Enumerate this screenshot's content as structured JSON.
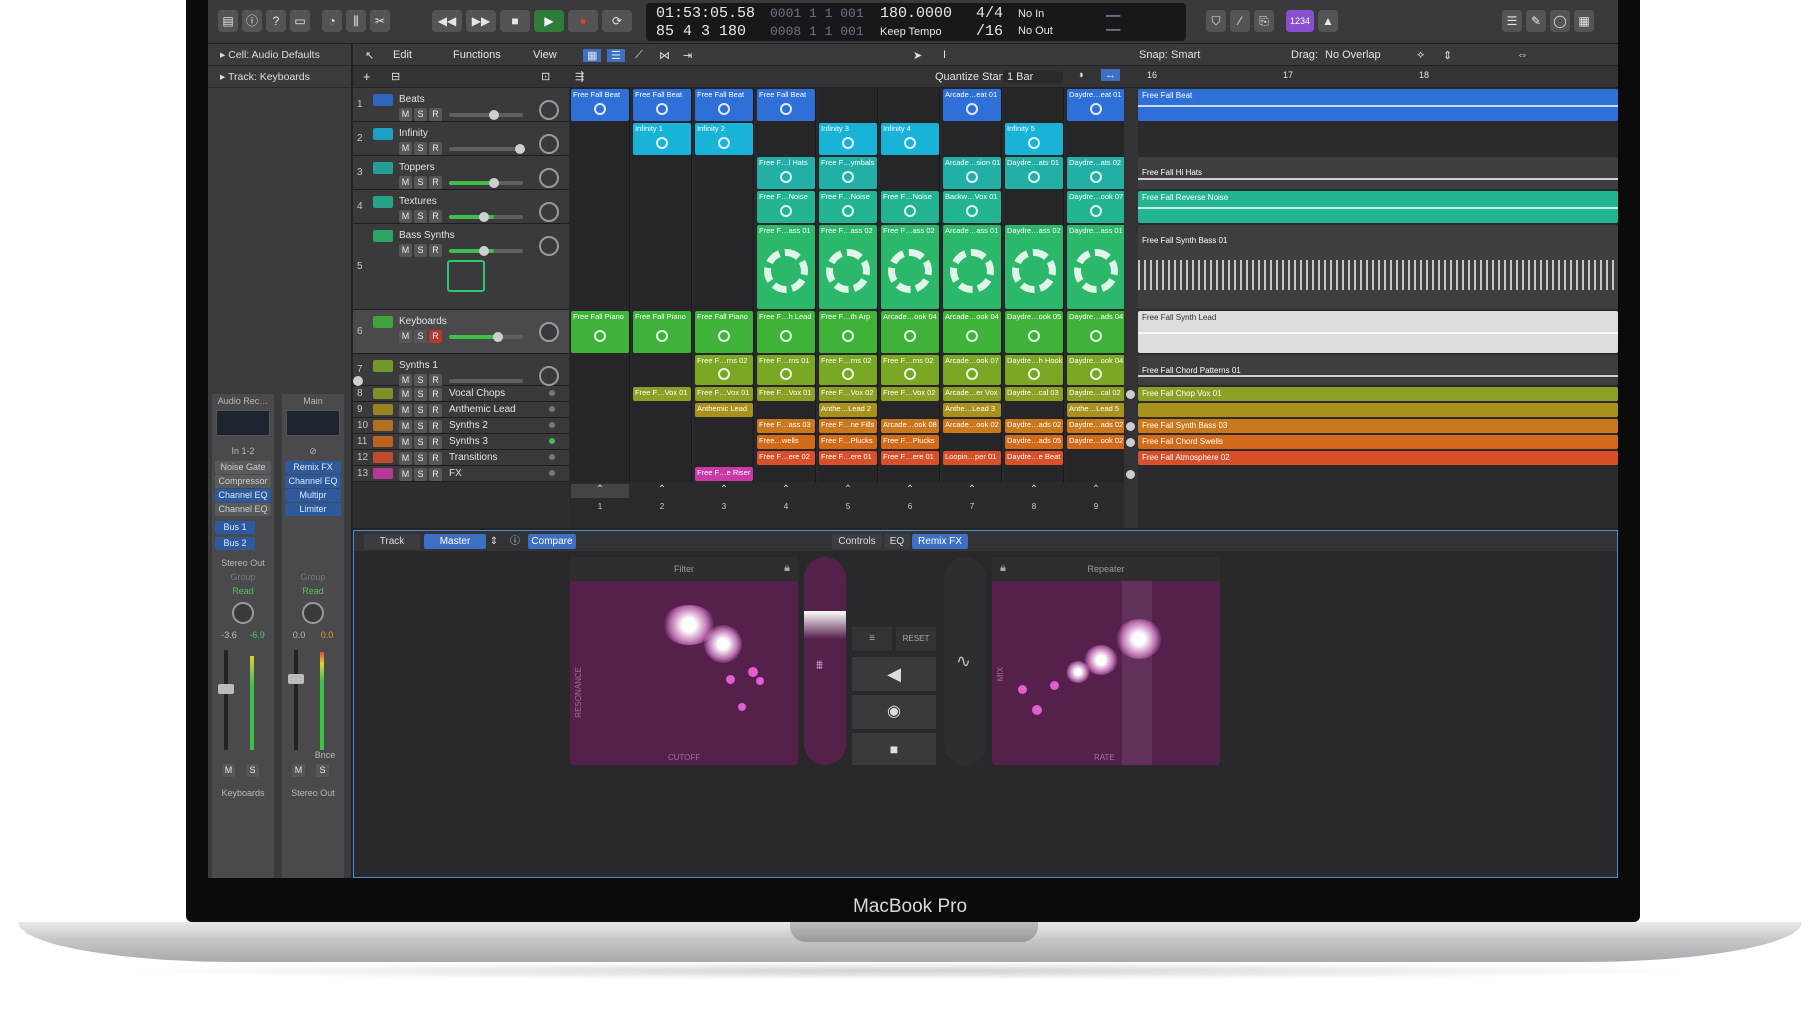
{
  "device": {
    "brand": "MacBook Pro"
  },
  "control_bar": {
    "position_time": "01:53:05.58",
    "position_bars": "85  4  3  180",
    "tempo": "180.0000",
    "tempo_mode": "Keep Tempo",
    "signature": "4/4",
    "division": "/16",
    "midi_in": "No In",
    "midi_out": "No Out",
    "count_in": "1234",
    "locator_top": "0001  1  1  001",
    "locator_bottom": "0008  1  1  001"
  },
  "inspector": {
    "cell_row": "Cell: Audio Defaults",
    "track_row": "Track:  Keyboards",
    "strip1": {
      "label": "Audio Rec…",
      "input": "In 1-2",
      "plugins": [
        "Noise Gate",
        "Compressor",
        "Channel EQ",
        "Channel EQ"
      ],
      "sends": [
        "Bus 1",
        "Bus 2"
      ],
      "output": "Stereo Out",
      "group": "Group",
      "automation": "Read",
      "vol": "-3.6",
      "peak": "-6.9",
      "name": "Keyboards"
    },
    "strip2": {
      "label": "Main",
      "plugins": [
        "Remix FX",
        "Channel EQ",
        "Multipr",
        "Limiter"
      ],
      "group": "Group",
      "automation": "Read",
      "vol": "0.0",
      "peak": "0.0",
      "extra": "Bnce",
      "name": "Stereo Out"
    }
  },
  "menus": {
    "edit": "Edit",
    "functions": "Functions",
    "view": "View",
    "snap_label": "Snap:",
    "snap_value": "Smart",
    "drag_label": "Drag:",
    "drag_value": "No Overlap",
    "quantize_label": "Quantize Start:",
    "quantize_value": "1 Bar"
  },
  "ruler": {
    "marks": [
      "16",
      "17",
      "18"
    ]
  },
  "tracks": [
    {
      "num": "1",
      "name": "Beats",
      "color": "#2f6fd8"
    },
    {
      "num": "2",
      "name": "Infinity",
      "color": "#19b3d8"
    },
    {
      "num": "3",
      "name": "Toppers",
      "color": "#22b0a6"
    },
    {
      "num": "4",
      "name": "Textures",
      "color": "#23b592"
    },
    {
      "num": "5",
      "name": "Bass Synths",
      "color": "#2bb86a"
    },
    {
      "num": "6",
      "name": "Keyboards",
      "color": "#3fb23a"
    },
    {
      "num": "7",
      "name": "Synths 1",
      "color": "#7aa825"
    },
    {
      "num": "8",
      "name": "Vocal Chops",
      "color": "#8f9e24"
    },
    {
      "num": "9",
      "name": "Anthemic Lead",
      "color": "#a8911c"
    },
    {
      "num": "10",
      "name": "Synths 2",
      "color": "#c9781c"
    },
    {
      "num": "11",
      "name": "Synths 3",
      "color": "#d26a1a"
    },
    {
      "num": "12",
      "name": "Transitions",
      "color": "#d8502a"
    },
    {
      "num": "13",
      "name": "FX",
      "color": "#c93aa6"
    }
  ],
  "cells": [
    [
      "Free Fall Beat",
      "Free Fall Beat",
      "Free Fall Beat",
      "Free Fall Beat",
      "",
      "",
      "Arcade…eat 01",
      "",
      "Daydre…eat 01"
    ],
    [
      "",
      "Infinity 1",
      "Infinity 2",
      "",
      "Infinity 3",
      "Infinity 4",
      "",
      "Infinity 5",
      ""
    ],
    [
      "",
      "",
      "",
      "Free F…l Hats",
      "Free F…ymbals",
      "",
      "Arcade…sion 01",
      "Daydre…ats 01",
      "Daydre…ats 02"
    ],
    [
      "",
      "",
      "",
      "Free F…Noise",
      "Free F…Noise",
      "Free F…Noise",
      "Backw…Vox 01",
      "",
      "Daydre…ook 07"
    ],
    [
      "",
      "",
      "",
      "Free F…ass 01",
      "Free F…ass 02",
      "Free F…ass 02",
      "Arcade…ass 01",
      "Daydre…ass 02",
      "Daydre…ass 01"
    ],
    [
      "Free Fall Piano",
      "Free Fall Piano",
      "Free Fall Piano",
      "Free F…h Lead",
      "Free F…th Arp",
      "Arcade…ook 04",
      "Arcade…ook 04",
      "Daydre…ook 05",
      "Daydre…ads 04"
    ],
    [
      "",
      "",
      "Free F…rns 02",
      "Free F…rns 01",
      "Free F…rns 02",
      "Free F…rns 02",
      "Arcade…ook 07",
      "Daydre…h Hook",
      "Daydre…ook 04"
    ],
    [
      "",
      "Free F…Vox 01",
      "Free F…Vox 01",
      "Free F…Vox 01",
      "Free F…Vox 02",
      "Free F…Vox 02",
      "Arcade…er Vox",
      "Daydre…cal 03",
      "Daydre…cal 02"
    ],
    [
      "",
      "",
      "Anthemic Lead",
      "",
      "Anthe…Lead 2",
      "",
      "Anthe…Lead 3",
      "",
      "Anthe…Lead 5"
    ],
    [
      "",
      "",
      "",
      "Free F…ass 03",
      "Free F…ne Fills",
      "Arcade…ook 08",
      "Arcade…ook 02",
      "Daydre…ads 02",
      "Daydre…ads 02"
    ],
    [
      "",
      "",
      "",
      "Free…wells",
      "Free F…Plucks",
      "Free F…Plucks",
      "",
      "Daydre…ads 05",
      "Daydre…ook 02"
    ],
    [
      "",
      "",
      "",
      "Free F…ere 02",
      "Free F…ere 01",
      "Free F…ere 01",
      "Loopin…per 01",
      "Daydre…e Beat",
      ""
    ],
    [
      "",
      "",
      "Free F…e Riser",
      "",
      "",
      "",
      "",
      "",
      ""
    ]
  ],
  "scene_numbers": [
    "1",
    "2",
    "3",
    "4",
    "5",
    "6",
    "7",
    "8",
    "9"
  ],
  "regions": [
    "Free Fall Beat",
    "",
    "Free Fall Hi Hats",
    "Free Fall Reverse Noise",
    "Free Fall Synth Bass 01",
    "Free Fall Synth Lead",
    "Free Fall Chord Patterns 01",
    "Free Fall Chop Vox 01",
    "",
    "Free Fall Synth Bass 03",
    "Free Fall Chord Swells",
    "Free Fall Atmosphere 02",
    ""
  ],
  "editor": {
    "tab_track": "Track",
    "tab_master": "Master",
    "compare": "Compare",
    "tab_controls": "Controls",
    "tab_eq": "EQ",
    "tab_remix": "Remix FX",
    "filter_title": "Filter",
    "repeater_title": "Repeater",
    "filter_y": "RESONANCE",
    "filter_x": "CUTOFF",
    "repeater_y": "MIX",
    "repeater_x": "RATE",
    "reset": "RESET"
  }
}
